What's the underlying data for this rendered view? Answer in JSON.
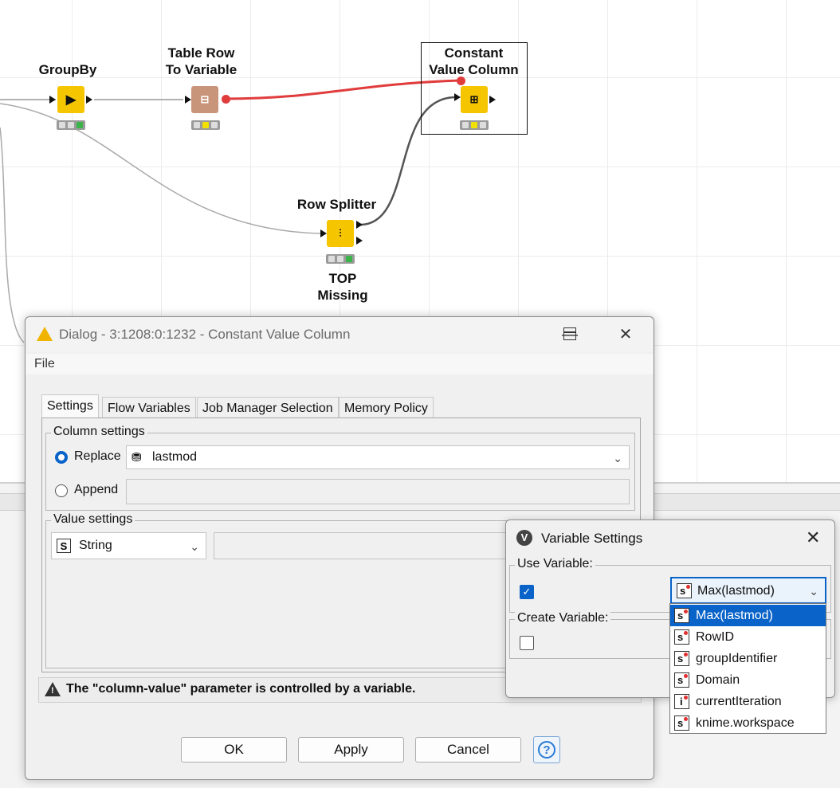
{
  "workflow": {
    "nodes": [
      {
        "id": "groupby",
        "label_lines": [
          "GroupBy"
        ]
      },
      {
        "id": "table-row-to-variable",
        "label_lines": [
          "Table Row",
          "To Variable"
        ]
      },
      {
        "id": "constant-value-column",
        "label_lines": [
          "Constant",
          "Value Column"
        ]
      },
      {
        "id": "row-splitter",
        "label_lines": [
          "Row Splitter"
        ],
        "bottom_lines": [
          "TOP",
          "Missing"
        ]
      }
    ]
  },
  "dialog": {
    "title": "Dialog - 3:1208:0:1232 - Constant Value Column",
    "menu_file": "File",
    "tabs": [
      "Settings",
      "Flow Variables",
      "Job Manager Selection",
      "Memory Policy"
    ],
    "column_settings": {
      "title": "Column settings",
      "replace_label": "Replace",
      "replace_value": "lastmod",
      "append_label": "Append"
    },
    "value_settings": {
      "title": "Value settings",
      "type_value": "String",
      "type_badge": "S"
    },
    "warning": "The \"column-value\" parameter is controlled by a variable.",
    "buttons": {
      "ok": "OK",
      "apply": "Apply",
      "cancel": "Cancel",
      "help": "?"
    }
  },
  "variable_settings": {
    "title": "Variable Settings",
    "icon_letter": "V",
    "use_variable_label": "Use Variable:",
    "use_variable_checked": true,
    "selected_variable": "Max(lastmod)",
    "create_variable_label": "Create Variable:",
    "create_variable_checked": false,
    "options": [
      {
        "type": "s",
        "name": "Max(lastmod)",
        "selected": true
      },
      {
        "type": "s",
        "name": "RowID"
      },
      {
        "type": "s",
        "name": "groupIdentifier"
      },
      {
        "type": "s",
        "name": "Domain"
      },
      {
        "type": "i",
        "name": "currentIteration"
      },
      {
        "type": "s",
        "name": "knime.workspace"
      }
    ]
  },
  "colors": {
    "accent": "#0a63c9",
    "node_yellow": "#f5c600",
    "node_brown": "#c9957a",
    "flow_red": "#e03c3c"
  }
}
